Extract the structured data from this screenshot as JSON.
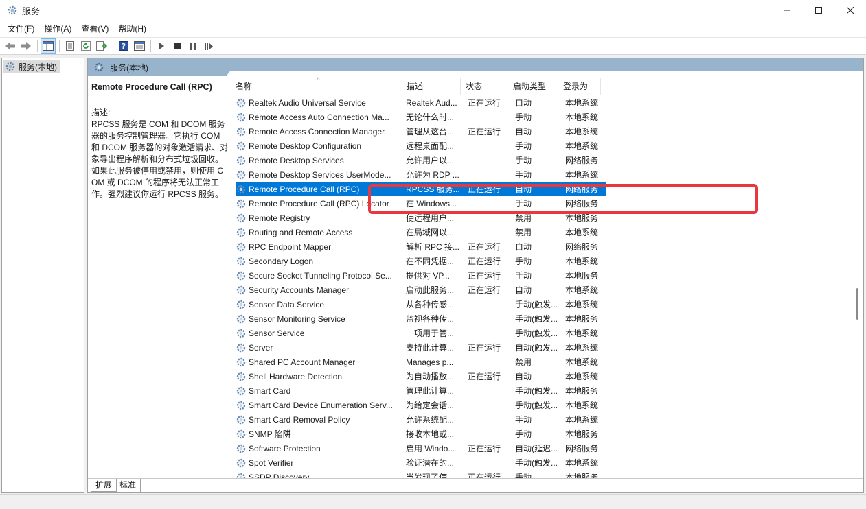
{
  "window": {
    "title": "服务",
    "controls": {
      "minimize": "—",
      "maximize": "☐",
      "close": "✕"
    }
  },
  "menubar": [
    "文件(F)",
    "操作(A)",
    "查看(V)",
    "帮助(H)"
  ],
  "toolbar": {
    "icons": [
      "back-icon",
      "forward-icon",
      "show-hide-console-tree-icon",
      "properties-icon",
      "refresh-icon",
      "export-list-icon",
      "help-icon",
      "view-icon",
      "start-service-icon",
      "stop-service-icon",
      "pause-service-icon",
      "restart-service-icon"
    ]
  },
  "tree": {
    "root_label": "服务(本地)"
  },
  "pane": {
    "header": "服务(本地)",
    "selected_service": "Remote Procedure Call (RPC)",
    "desc_label": "描述:",
    "desc_text": "RPCSS 服务是 COM 和 DCOM 服务器的服务控制管理器。它执行 COM 和 DCOM 服务器的对象激活请求、对象导出程序解析和分布式垃圾回收。如果此服务被停用或禁用，则使用 COM 或 DCOM 的程序将无法正常工作。强烈建议你运行 RPCSS 服务。"
  },
  "columns": {
    "name": "名称",
    "desc": "描述",
    "status": "状态",
    "startup": "启动类型",
    "logon": "登录为"
  },
  "services": [
    {
      "name": "Realtek Audio Universal Service",
      "desc": "Realtek Aud...",
      "status": "正在运行",
      "startup": "自动",
      "logon": "本地系统"
    },
    {
      "name": "Remote Access Auto Connection Ma...",
      "desc": "无论什么时...",
      "status": "",
      "startup": "手动",
      "logon": "本地系统"
    },
    {
      "name": "Remote Access Connection Manager",
      "desc": "管理从这台...",
      "status": "正在运行",
      "startup": "自动",
      "logon": "本地系统"
    },
    {
      "name": "Remote Desktop Configuration",
      "desc": "远程桌面配...",
      "status": "",
      "startup": "手动",
      "logon": "本地系统"
    },
    {
      "name": "Remote Desktop Services",
      "desc": "允许用户以...",
      "status": "",
      "startup": "手动",
      "logon": "网络服务"
    },
    {
      "name": "Remote Desktop Services UserMode...",
      "desc": "允许为 RDP ...",
      "status": "",
      "startup": "手动",
      "logon": "本地系统"
    },
    {
      "name": "Remote Procedure Call (RPC)",
      "desc": "RPCSS 服务...",
      "status": "正在运行",
      "startup": "自动",
      "logon": "网络服务",
      "selected": true
    },
    {
      "name": "Remote Procedure Call (RPC) Locator",
      "desc": "在 Windows...",
      "status": "",
      "startup": "手动",
      "logon": "网络服务"
    },
    {
      "name": "Remote Registry",
      "desc": "使远程用户...",
      "status": "",
      "startup": "禁用",
      "logon": "本地服务"
    },
    {
      "name": "Routing and Remote Access",
      "desc": "在局域网以...",
      "status": "",
      "startup": "禁用",
      "logon": "本地系统"
    },
    {
      "name": "RPC Endpoint Mapper",
      "desc": "解析 RPC 接...",
      "status": "正在运行",
      "startup": "自动",
      "logon": "网络服务"
    },
    {
      "name": "Secondary Logon",
      "desc": "在不同凭据...",
      "status": "正在运行",
      "startup": "手动",
      "logon": "本地系统"
    },
    {
      "name": "Secure Socket Tunneling Protocol Se...",
      "desc": "提供对 VP...",
      "status": "正在运行",
      "startup": "手动",
      "logon": "本地服务"
    },
    {
      "name": "Security Accounts Manager",
      "desc": "启动此服务...",
      "status": "正在运行",
      "startup": "自动",
      "logon": "本地系统"
    },
    {
      "name": "Sensor Data Service",
      "desc": "从各种传感...",
      "status": "",
      "startup": "手动(触发...",
      "logon": "本地系统"
    },
    {
      "name": "Sensor Monitoring Service",
      "desc": "监视各种传...",
      "status": "",
      "startup": "手动(触发...",
      "logon": "本地服务"
    },
    {
      "name": "Sensor Service",
      "desc": "一项用于管...",
      "status": "",
      "startup": "手动(触发...",
      "logon": "本地系统"
    },
    {
      "name": "Server",
      "desc": "支持此计算...",
      "status": "正在运行",
      "startup": "自动(触发...",
      "logon": "本地系统"
    },
    {
      "name": "Shared PC Account Manager",
      "desc": "Manages p...",
      "status": "",
      "startup": "禁用",
      "logon": "本地系统"
    },
    {
      "name": "Shell Hardware Detection",
      "desc": "为自动播放...",
      "status": "正在运行",
      "startup": "自动",
      "logon": "本地系统"
    },
    {
      "name": "Smart Card",
      "desc": "管理此计算...",
      "status": "",
      "startup": "手动(触发...",
      "logon": "本地服务"
    },
    {
      "name": "Smart Card Device Enumeration Serv...",
      "desc": "为给定会话...",
      "status": "",
      "startup": "手动(触发...",
      "logon": "本地系统"
    },
    {
      "name": "Smart Card Removal Policy",
      "desc": "允许系统配...",
      "status": "",
      "startup": "手动",
      "logon": "本地系统"
    },
    {
      "name": "SNMP 陷阱",
      "desc": "接收本地或...",
      "status": "",
      "startup": "手动",
      "logon": "本地服务"
    },
    {
      "name": "Software Protection",
      "desc": "启用 Windo...",
      "status": "正在运行",
      "startup": "自动(延迟...",
      "logon": "网络服务"
    },
    {
      "name": "Spot Verifier",
      "desc": "验证潜在的...",
      "status": "",
      "startup": "手动(触发...",
      "logon": "本地系统"
    },
    {
      "name": "SSDP Discovery",
      "desc": "当发现了使...",
      "status": "正在运行",
      "startup": "手动",
      "logon": "本地服务"
    }
  ],
  "tabs": [
    "扩展",
    "标准"
  ],
  "colors": {
    "selection": "#0078d7",
    "highlight_box": "#e8383d",
    "pane_header": "#98b4cd"
  }
}
